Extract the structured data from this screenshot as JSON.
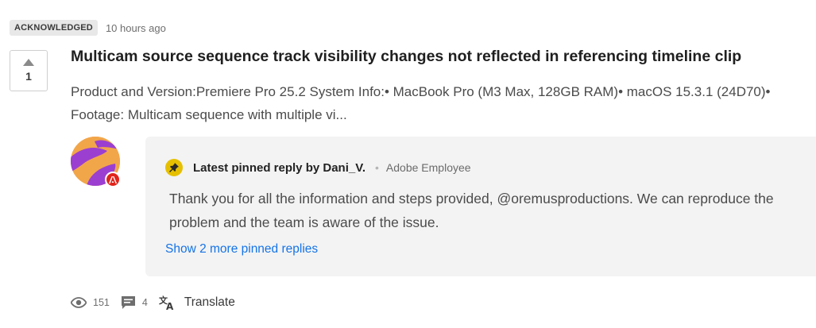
{
  "post": {
    "status": "ACKNOWLEDGED",
    "time": "10 hours ago",
    "votes": "1",
    "title": "Multicam source sequence track visibility changes not reflected in referencing timeline clip",
    "excerpt": "Product and Version:Premiere Pro 25.2 System Info:• MacBook Pro (M3 Max, 128GB RAM)• macOS 15.3.1 (24D70)• Footage: Multicam sequence with multiple vi..."
  },
  "pinned": {
    "label": "Latest pinned reply by Dani_V.",
    "role": "Adobe Employee",
    "separator": "•",
    "text": "Thank you for all the information and steps provided, @oremusproductions. We can reproduce the problem and the team is aware of the issue.",
    "more_link": "Show 2 more pinned replies"
  },
  "footer": {
    "views": "151",
    "comments": "4",
    "translate": "Translate"
  },
  "icons": {
    "upvote": "upvote-arrow-icon",
    "pin": "pin-icon",
    "adobe": "adobe-logo-icon",
    "views": "eye-icon",
    "comments": "comment-icon",
    "translate": "translate-icon"
  },
  "colors": {
    "link": "#1473e6",
    "pin_badge": "#e6c000",
    "adobe_red": "#e1251b",
    "avatar_orange": "#f2a64a",
    "avatar_purple": "#9b3fd1"
  }
}
